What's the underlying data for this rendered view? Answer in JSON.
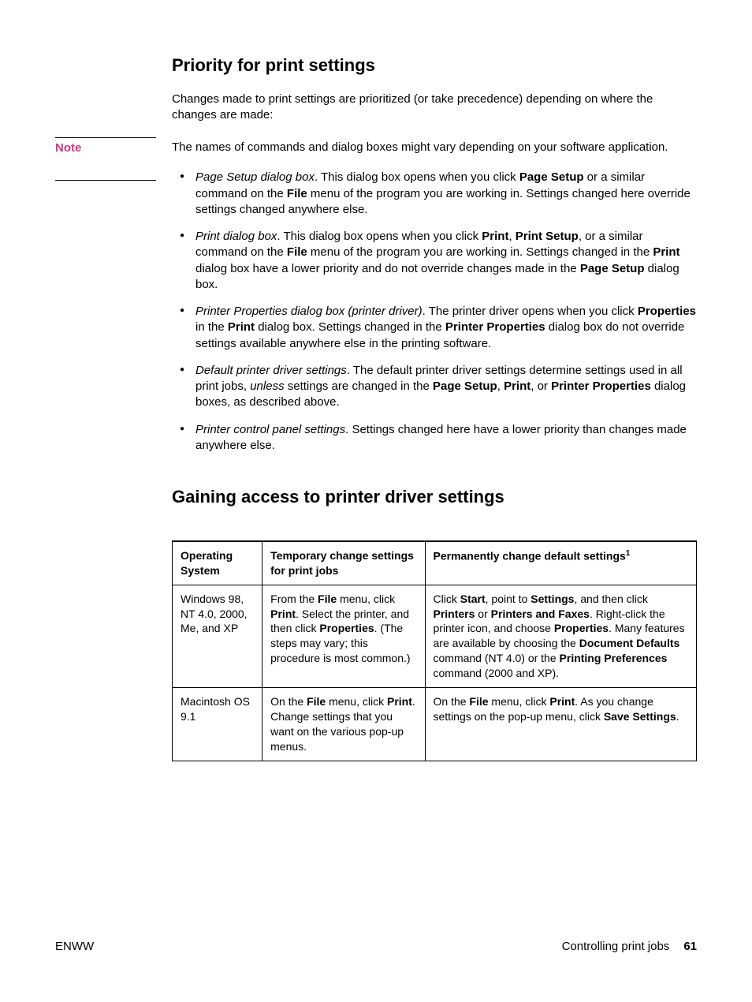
{
  "section1": {
    "heading": "Priority for print settings",
    "intro": "Changes made to print settings are prioritized (or take precedence) depending on where the changes are made:",
    "note_label": "Note",
    "note_body": "The names of commands and dialog boxes might vary depending on your software application.",
    "bullets": {
      "b1": {
        "lead_italic": "Page Setup dialog box",
        "t1": ". This dialog box opens when you click ",
        "b1": "Page Setup",
        "t2": " or a similar command on the ",
        "b2": "File",
        "t3": " menu of the program you are working in. Settings changed here override settings changed anywhere else."
      },
      "b2": {
        "lead_italic": "Print dialog box",
        "t1": ". This dialog box opens when you click ",
        "b1": "Print",
        "t2": ", ",
        "b2": "Print Setup",
        "t3": ", or a similar command on the ",
        "b3": "File",
        "t4": " menu of the program you are working in. Settings changed in the ",
        "b4": "Print",
        "t5": " dialog box have a lower priority and do not override changes made in the ",
        "b5": "Page Setup",
        "t6": " dialog box."
      },
      "b3": {
        "lead_italic": "Printer Properties dialog box (printer driver)",
        "t1": ". The printer driver opens when you click ",
        "b1": "Properties",
        "t2": " in the ",
        "b2": "Print",
        "t3": " dialog box. Settings changed in the ",
        "b3": "Printer Properties",
        "t4": " dialog box do not override settings available anywhere else in the printing software."
      },
      "b4": {
        "lead_italic": "Default printer driver settings",
        "t1": ". The default printer driver settings determine settings used in all print jobs, ",
        "i1": "unless",
        "t2": " settings are changed in the ",
        "b1": "Page Setup",
        "t3": ", ",
        "b2": "Print",
        "t4": ", or ",
        "b3": "Printer Properties",
        "t5": " dialog boxes, as described above."
      },
      "b5": {
        "lead_italic": "Printer control panel settings",
        "t1": ". Settings changed here have a lower priority than changes made anywhere else."
      }
    }
  },
  "section2": {
    "heading": "Gaining access to printer driver settings",
    "table": {
      "headers": {
        "c1": "Operating System",
        "c2": "Temporary change settings for print jobs",
        "c3_a": "Permanently change default settings",
        "c3_sup": "1"
      },
      "row1": {
        "c1": "Windows 98, NT 4.0, 2000, Me, and XP",
        "c2": {
          "t1": "From the ",
          "b1": "File",
          "t2": " menu, click ",
          "b2": "Print",
          "t3": ". Select the printer, and then click ",
          "b3": "Properties",
          "t4": ". (The steps may vary; this procedure is most common.)"
        },
        "c3": {
          "t1": "Click ",
          "b1": "Start",
          "t2": ", point to ",
          "b2": "Settings",
          "t3": ", and then click ",
          "b3": "Printers",
          "t4": " or ",
          "b4": "Printers and Faxes",
          "t5": ". Right-click the printer icon, and choose ",
          "b5": "Properties",
          "t6": ". Many features are available by choosing the ",
          "b6": "Document Defaults",
          "t7": " command (NT 4.0) or the ",
          "b7": "Printing Preferences",
          "t8": " command (2000 and XP)."
        }
      },
      "row2": {
        "c1": "Macintosh OS 9.1",
        "c2": {
          "t1": "On the ",
          "b1": "File",
          "t2": " menu, click ",
          "b2": "Print",
          "t3": ". Change settings that you want on the various pop-up menus."
        },
        "c3": {
          "t1": "On the ",
          "b1": "File",
          "t2": " menu, click ",
          "b2": "Print",
          "t3": ". As you change settings on the pop-up menu, click ",
          "b3": "Save Settings",
          "t4": "."
        }
      }
    }
  },
  "footer": {
    "left": "ENWW",
    "right_text": "Controlling print jobs",
    "page": "61"
  }
}
